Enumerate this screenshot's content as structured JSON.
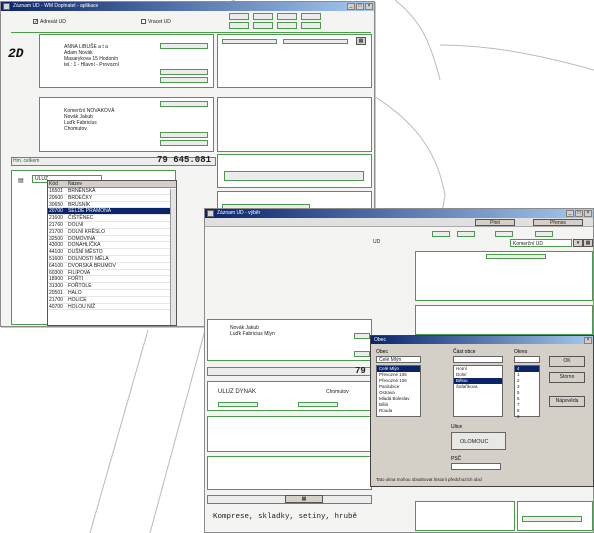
{
  "win1": {
    "title": "Záznam UD - WM Doplnatel - aplikace",
    "check_ud": "Adresát UD",
    "check_vuj": "Vracet UD",
    "logo": "2D",
    "sender_lines": [
      "ANNA LIBUŠE  a t a",
      "Adam Novák",
      "Masarykova 15 Hodonín",
      "tel.: 1 - Hlavní - Provozní"
    ],
    "recipient_lines": [
      "Komerční NOVAKOVÁ",
      "Novák Jakub",
      "Luďk Fabricius",
      "Chomutov"
    ],
    "sum_label": "Hm. celkem",
    "sum_value": "79  645.081",
    "city_field": "ULUZ",
    "list": {
      "headers": [
        "Kód",
        "Název"
      ],
      "rows": [
        [
          "16501",
          "BRNĚNSKÁ"
        ],
        [
          "20600",
          "BRDEČKY"
        ],
        [
          "30650",
          "BRUSNÍK"
        ],
        [
          "20700",
          "SELDE PRAMONA"
        ],
        [
          "21600",
          "ČIŠTĚNEC"
        ],
        [
          "21760",
          "DOLNÍ"
        ],
        [
          "21700",
          "DOLNÍ KRĚSLO"
        ],
        [
          "32500",
          "DOMOVINA"
        ],
        [
          "43000",
          "DONAHLÍČKA"
        ],
        [
          "44100",
          "DUŠNÍ MĚSTO"
        ],
        [
          "51600",
          "DOLNOSTI MĚLA"
        ],
        [
          "64100",
          "DVORSKÁ BRUMOV"
        ],
        [
          "60300",
          "FILIPOVA"
        ],
        [
          "18900",
          "FOŘTI"
        ],
        [
          "31300",
          "FOŘTOLE"
        ],
        [
          "20501",
          "HALO"
        ],
        [
          "21700",
          "HOLICE"
        ],
        [
          "40700",
          "HOLOU NÍŽ"
        ]
      ]
    }
  },
  "win2": {
    "title": "Záznam UD - výběr",
    "tab_a": "Plnit",
    "tab_b": "Přenos",
    "toolbar_label": "UD",
    "combo_value": "Komerční UD",
    "recipient_lines": [
      "Novák Jakub",
      "Luďk Fabricius Mlyn"
    ],
    "sum_value": "79",
    "city_value": "ULUZ DYNAK",
    "city_other": "Chomutov",
    "bottom_text": "Komprese, skladky, setiny, hrubě",
    "label_a": "Adresát",
    "label_b": "Zpět"
  },
  "dlg": {
    "title": "Obec",
    "col1_label": "Obec",
    "col1_value": "Celé Mlýn",
    "col1_items": [
      "Celé Mlýn",
      "Převozné 105",
      "Převozné 106",
      "Pardubice",
      "Ostrava",
      "Mladá Boleslav",
      "Bělá",
      "Rouda"
    ],
    "col2_label": "Část obce",
    "col2_items": [
      "Horní",
      "Dolní",
      "Bělou",
      "Šafaříkova"
    ],
    "col3_label": "Okres",
    "col3_items": [
      "4",
      "1",
      "2",
      "3",
      "5",
      "6",
      "7",
      "8",
      "9"
    ],
    "btn_ok": "OK",
    "btn_cancel": "Storno",
    "btn_help": "Nápověda",
    "stat_label": "Ulice",
    "stat_value": "OLOMOUC",
    "psc_label": "PSČ",
    "status": "Tato okna mohou obsahovat historii předchozích obcí"
  }
}
